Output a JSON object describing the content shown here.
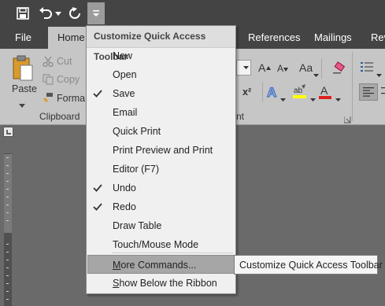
{
  "quick_access": {
    "save_icon": "save-icon",
    "undo_icon": "undo-icon",
    "undo_dropdown_icon": "chevron-down-icon",
    "redo_icon": "redo-icon",
    "customize_icon": "customize-qat-icon"
  },
  "tabs": [
    {
      "label": "File"
    },
    {
      "label": "Home",
      "active": true
    },
    {
      "label": "References"
    },
    {
      "label": "Mailings"
    },
    {
      "label": "Rev"
    }
  ],
  "ribbon": {
    "clipboard": {
      "paste_label": "Paste",
      "cut_label": "Cut",
      "copy_label": "Copy",
      "format_label": "Forma",
      "group_label": "Clipboard"
    },
    "font": {
      "group_label_fragment": "nt",
      "size_grow": "A",
      "size_shrink": "A",
      "change_case": "Aa",
      "superscript": "x²",
      "highlight": "ab",
      "font_color": "A"
    }
  },
  "menu": {
    "header": "Customize Quick Access Toolbar",
    "items": [
      {
        "label": "New",
        "checked": false
      },
      {
        "label": "Open",
        "checked": false
      },
      {
        "label": "Save",
        "checked": true
      },
      {
        "label": "Email",
        "checked": false
      },
      {
        "label": "Quick Print",
        "checked": false
      },
      {
        "label": "Print Preview and Print",
        "checked": false
      },
      {
        "label": "Editor (F7)",
        "checked": false
      },
      {
        "label": "Undo",
        "checked": true
      },
      {
        "label": "Redo",
        "checked": true
      },
      {
        "label": "Draw Table",
        "checked": false
      },
      {
        "label": "Touch/Mouse Mode",
        "checked": false
      }
    ],
    "more_commands": {
      "mnemonic": "M",
      "rest": "ore Commands...",
      "highlighted": true
    },
    "show_below": {
      "mnemonic": "S",
      "rest": "how Below the Ribbon"
    }
  },
  "tooltip": {
    "text": "Customize Quick Access Toolbar"
  },
  "colors": {
    "titlebar": "#444444",
    "ribbon": "#c6c6c6",
    "document_bg": "#6a6a6a",
    "menu_bg": "#f0f0f0",
    "menu_highlight": "#a6a6a6",
    "highlight_yellow": "#ffff00",
    "font_color_red": "#e02020"
  }
}
